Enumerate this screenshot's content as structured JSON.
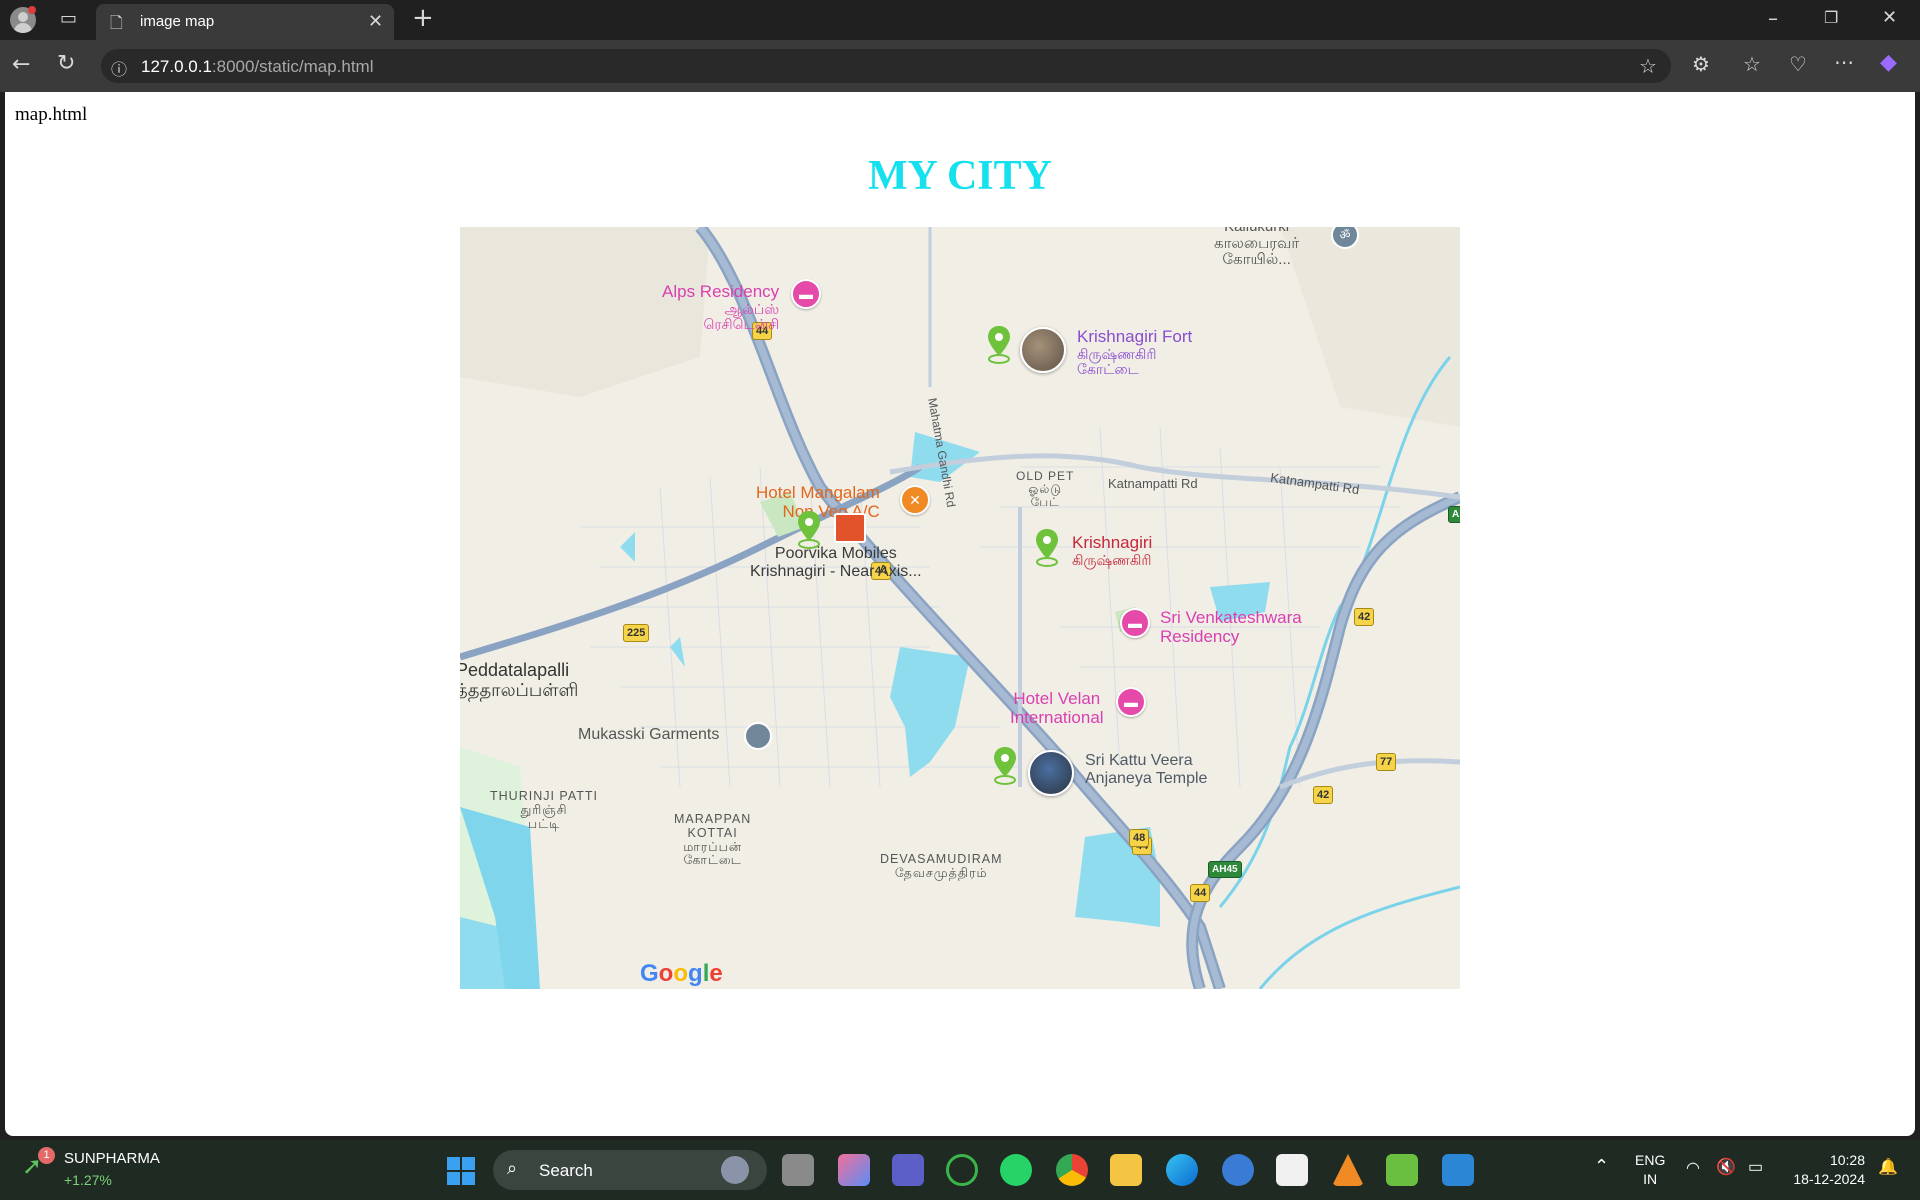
{
  "browser": {
    "tab_title": "image map",
    "url_host": "127.0.0.1",
    "url_rest": ":8000/static/map.html"
  },
  "page": {
    "label": "map.html",
    "title": "MY CITY"
  },
  "map": {
    "labels": {
      "alps_1": "Alps Residency",
      "alps_2": "ஆல்ப்ஸ்",
      "alps_3": "ரெசிடென்சி",
      "fort_1": "Krishnagiri Fort",
      "fort_2": "கிருஷ்ணகிரி",
      "fort_3": "கோட்டை",
      "kallukurki_1": "Kallukurki",
      "kallukurki_2": "காலபைரவர்",
      "kallukurki_3": "கோயில்...",
      "oldpet_1": "OLD PET",
      "oldpet_2": "ஓல்டு",
      "oldpet_3": "பேட்",
      "katnampatti_1": "Katnampatti Rd",
      "katnampatti_2": "Katnampatti Rd",
      "mahatma": "Mahatma Gandhi Rd",
      "mangalam_1": "Hotel Mangalam",
      "mangalam_2": "Non Veg A/C",
      "poorvika_1": "Poorvika Mobiles",
      "poorvika_2": "Krishnagiri - Near Axis...",
      "krishnagiri_1": "Krishnagiri",
      "krishnagiri_2": "கிருஷ்ணகிரி",
      "venkat_1": "Sri Venkateshwara",
      "venkat_2": "Residency",
      "velan_1": "Hotel Velan",
      "velan_2": "International",
      "peddatalapalli_1": "Peddatalapalli",
      "peddatalapalli_2": "த்ததாலப்பள்ளி",
      "mukasski": "Mukasski Garments",
      "temple_1": "Sri Kattu Veera",
      "temple_2": "Anjaneya Temple",
      "thurinji_1": "THURINJI PATTI",
      "thurinji_2": "துரிஞ்சி",
      "thurinji_3": "பட்டி",
      "marappan_1": "MARAPPAN",
      "marappan_2": "KOTTAI",
      "marappan_3": "மாரப்பன்",
      "marappan_4": "கோட்டை",
      "devasamudiram_1": "DEVASAMUDIRAM",
      "devasamudiram_2": "தேவசமுத்திரம்"
    },
    "shields": {
      "nh44_a": "44",
      "nh44_b": "44",
      "nh44_c": "44",
      "nh44_d": "44",
      "nh225": "225",
      "nh42_a": "42",
      "nh42_b": "42",
      "nh77": "77",
      "nh48": "48",
      "ah45": "AH45",
      "edge_a": "A"
    },
    "google_logo": "Google"
  },
  "taskbar": {
    "stock_name": "SUNPHARMA",
    "stock_change": "+1.27%",
    "stock_badge": "1",
    "search_label": "Search",
    "lang_1": "ENG",
    "lang_2": "IN",
    "time": "10:28",
    "date": "18-12-2024"
  },
  "colors": {
    "title": "#14e0ee",
    "hotel_pin": "#e64aa8",
    "attraction_pin": "#6fc23c"
  }
}
